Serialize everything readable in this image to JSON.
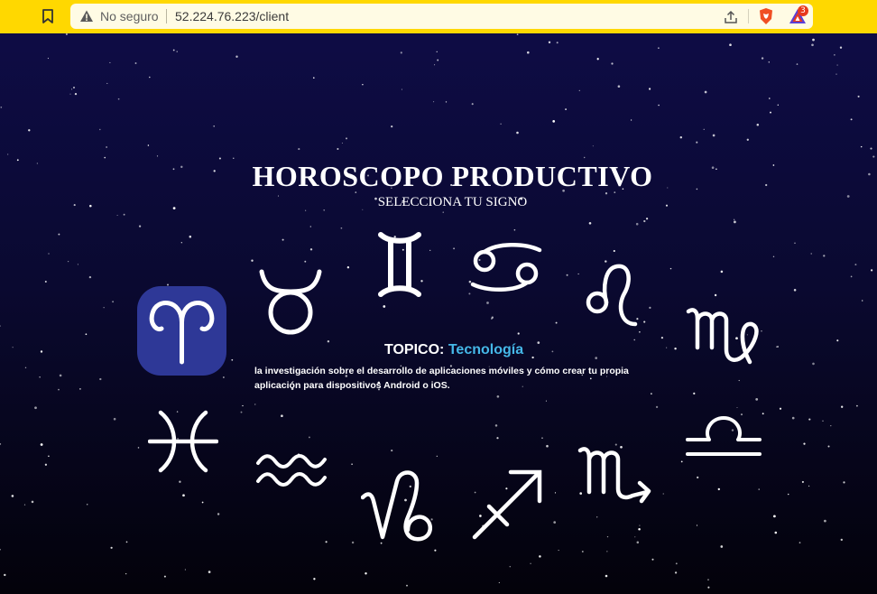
{
  "browser": {
    "security_label": "No seguro",
    "url": "52.224.76.223/client",
    "rewards_count": "3",
    "icons": [
      "bookmark-icon",
      "warning-icon",
      "share-icon",
      "brave-shield-icon",
      "brave-rewards-icon"
    ]
  },
  "page": {
    "title": "HOROSCOPO PRODUCTIVO",
    "subtitle": "SELECCIONA TU SIGNO",
    "topic_label": "TOPICO:",
    "topic_value": "Tecnología",
    "topic_description": "la investigación sobre el desarrollo de aplicaciones móviles y cómo crear tu propia aplicación para dispositivos Android o iOS.",
    "selected_sign": "aries",
    "signs": [
      "aries",
      "taurus",
      "gemini",
      "cancer",
      "leo",
      "virgo",
      "libra",
      "scorpio",
      "sagittarius",
      "capricorn",
      "aquarius",
      "pisces"
    ],
    "colors": {
      "background": "#0b0a33",
      "selected_tile": "#2e3897",
      "topic_accent": "#45b8e8",
      "chrome": "#ffd800"
    }
  }
}
